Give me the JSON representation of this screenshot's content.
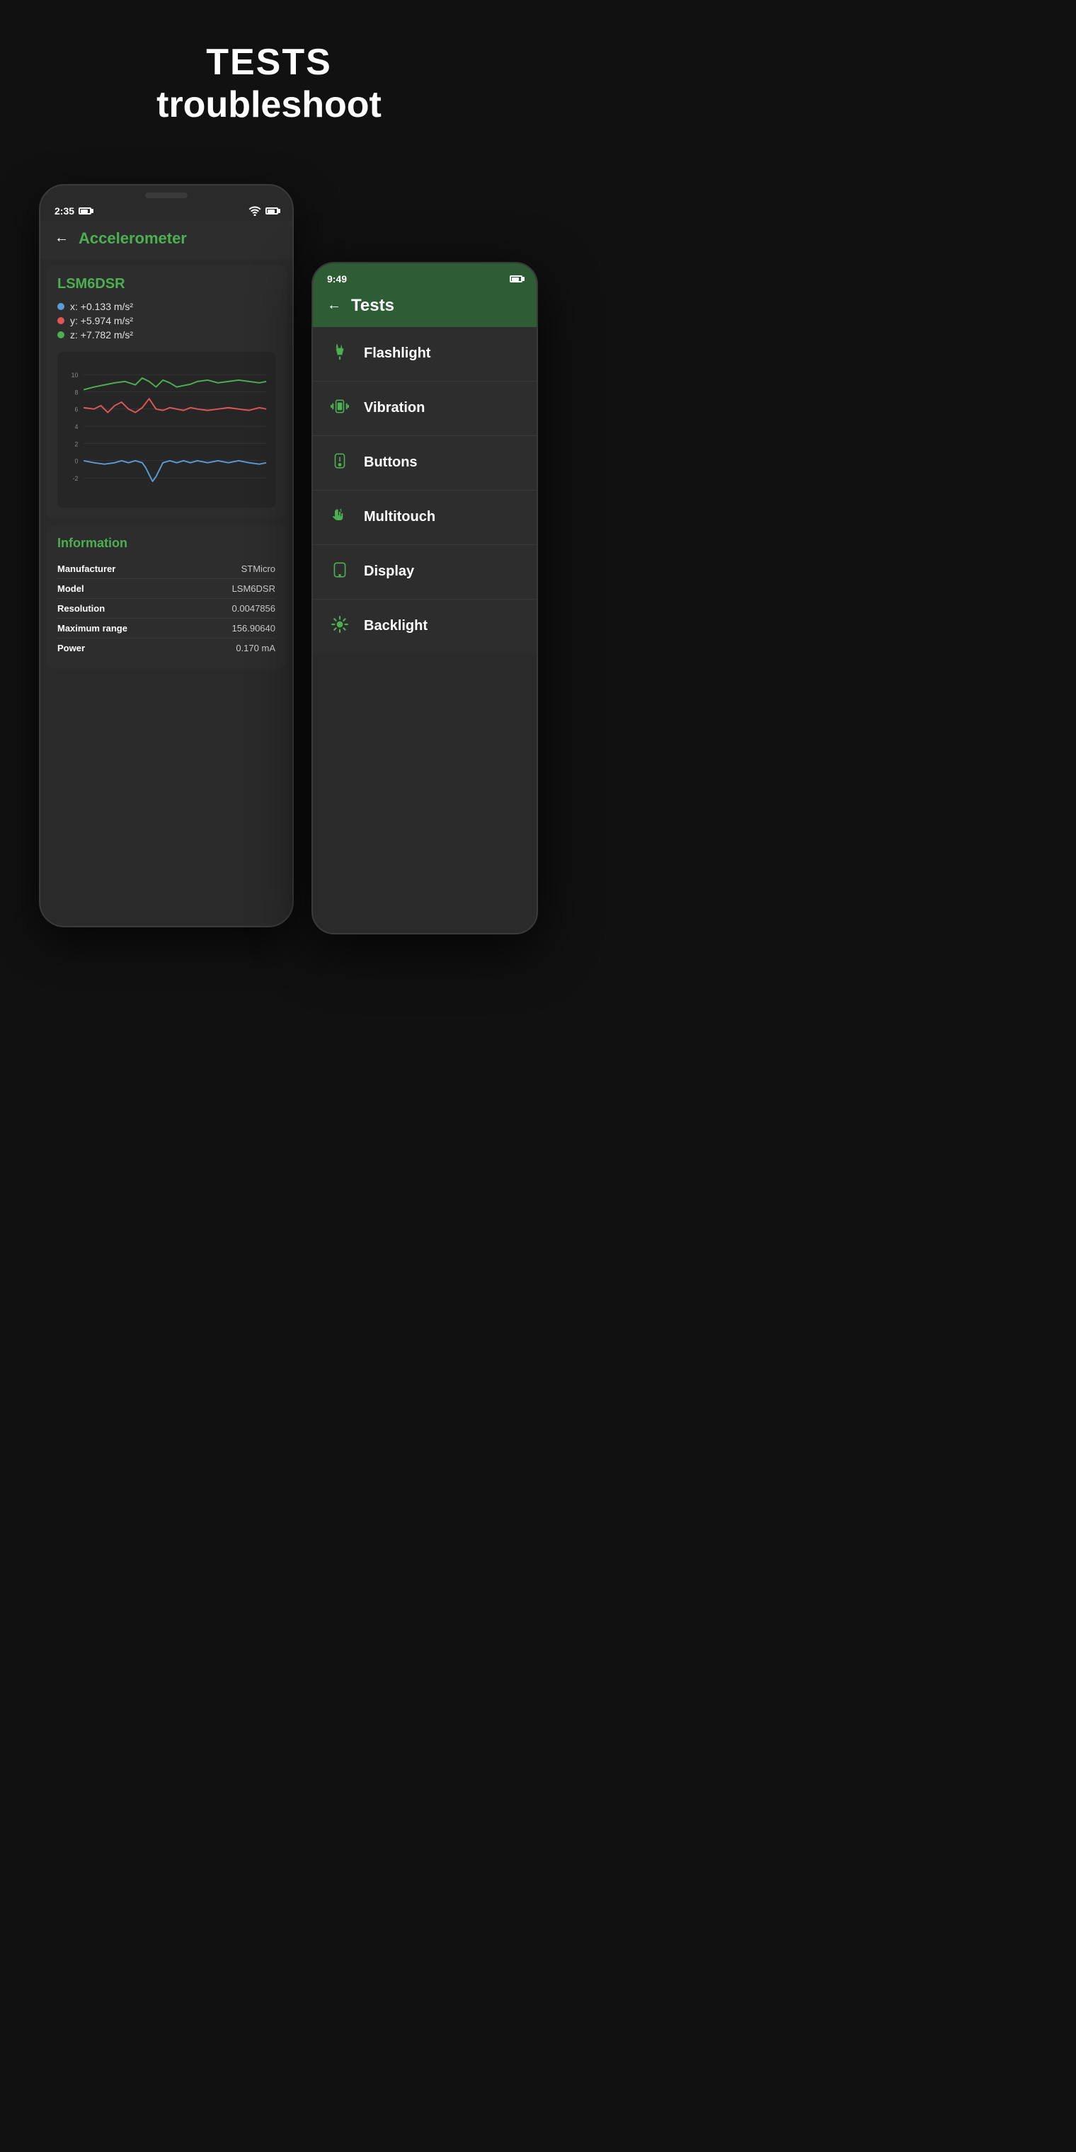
{
  "header": {
    "title": "TESTS",
    "subtitle": "troubleshoot"
  },
  "phone_back": {
    "status": {
      "time": "2:35",
      "battery": "🔋"
    },
    "screen_title": "Accelerometer",
    "sensor": {
      "name": "LSM6DSR",
      "x_value": "x: +0.133 m/s²",
      "y_value": "y: +5.974 m/s²",
      "z_value": "z: +7.782 m/s²"
    },
    "chart_y_labels": [
      "10",
      "8",
      "6",
      "4",
      "2",
      "0",
      "-2"
    ],
    "information": {
      "title": "Information",
      "rows": [
        {
          "label": "Manufacturer",
          "value": "STMicro"
        },
        {
          "label": "Model",
          "value": "LSM6DSR"
        },
        {
          "label": "Resolution",
          "value": "0.0047856"
        },
        {
          "label": "Maximum range",
          "value": "156.90640"
        },
        {
          "label": "Power",
          "value": "0.170 mA"
        }
      ]
    }
  },
  "phone_front": {
    "status": {
      "time": "9:49"
    },
    "screen_title": "Tests",
    "test_items": [
      {
        "id": "flashlight",
        "label": "Flashlight"
      },
      {
        "id": "vibration",
        "label": "Vibration"
      },
      {
        "id": "buttons",
        "label": "Buttons"
      },
      {
        "id": "multitouch",
        "label": "Multitouch"
      },
      {
        "id": "display",
        "label": "Display"
      },
      {
        "id": "backlight",
        "label": "Backlight"
      }
    ]
  }
}
